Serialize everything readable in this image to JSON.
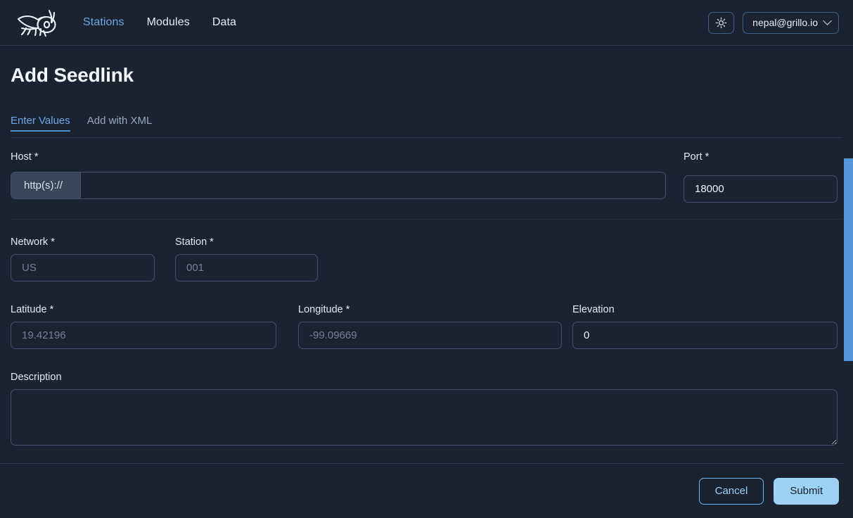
{
  "header": {
    "logo_icon": "cricket-logo-icon",
    "nav": [
      {
        "label": "Stations",
        "active": true
      },
      {
        "label": "Modules",
        "active": false
      },
      {
        "label": "Data",
        "active": false
      }
    ],
    "theme_toggle_icon": "sun-icon",
    "user_email": "nepal@grillo.io",
    "user_chevron_icon": "chevron-down-icon"
  },
  "page": {
    "title": "Add Seedlink"
  },
  "tabs": [
    {
      "label": "Enter Values",
      "active": true
    },
    {
      "label": "Add with XML",
      "active": false
    }
  ],
  "form": {
    "host": {
      "label": "Host *",
      "addon": "http(s)://",
      "value": "",
      "placeholder": ""
    },
    "port": {
      "label": "Port *",
      "value": "18000",
      "placeholder": ""
    },
    "network": {
      "label": "Network *",
      "value": "",
      "placeholder": "US"
    },
    "station": {
      "label": "Station *",
      "value": "",
      "placeholder": "001"
    },
    "latitude": {
      "label": "Latitude *",
      "value": "",
      "placeholder": "19.42196"
    },
    "longitude": {
      "label": "Longitude *",
      "value": "",
      "placeholder": "-99.09669"
    },
    "elevation": {
      "label": "Elevation",
      "value": "0",
      "placeholder": ""
    },
    "description": {
      "label": "Description",
      "value": "",
      "placeholder": ""
    }
  },
  "footer": {
    "cancel_label": "Cancel",
    "submit_label": "Submit"
  },
  "colors": {
    "background": "#1b2230",
    "accent_blue": "#6fa8e8",
    "submit_fill": "#9ed2f5",
    "scrollbar_thumb": "#5596db",
    "addon_fill": "#3a4558",
    "border": "#41506a"
  }
}
